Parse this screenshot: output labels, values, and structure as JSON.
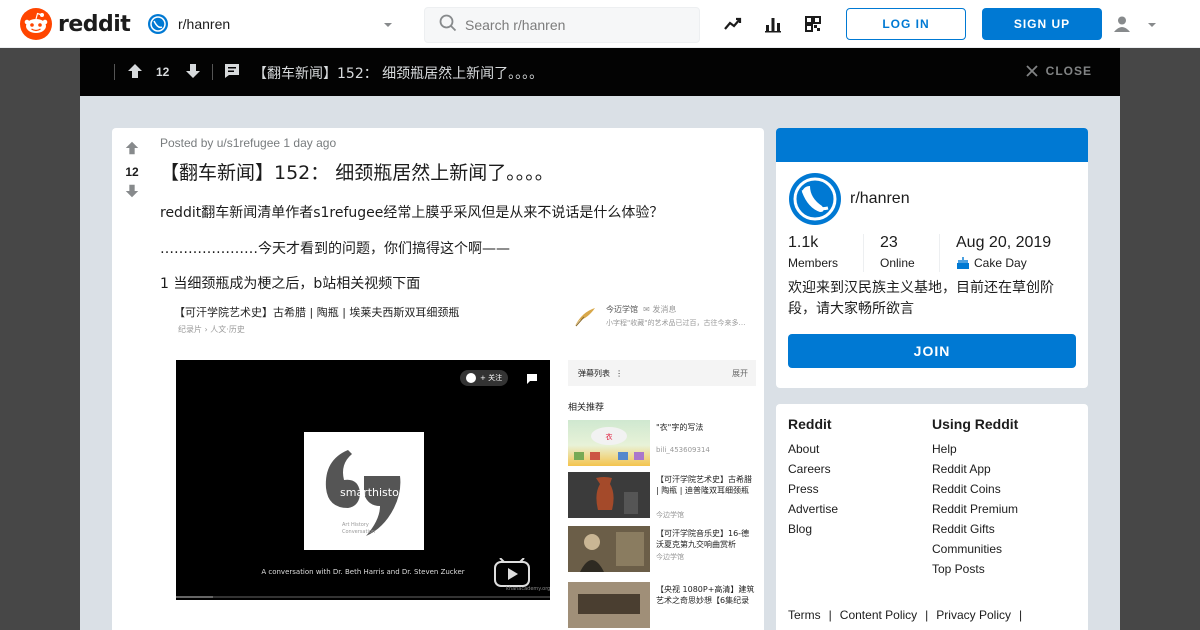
{
  "header": {
    "logo_text": "reddit",
    "community": "r/hanren",
    "search_placeholder": "Search r/hanren",
    "login_label": "LOG IN",
    "signup_label": "SIGN UP"
  },
  "topbar": {
    "score": "12",
    "title": "【翻车新闻】152： 细颈瓶居然上新闻了。。。。",
    "close_label": "CLOSE"
  },
  "post": {
    "score": "12",
    "meta": "Posted by u/s1refugee 1 day ago",
    "title": "【翻车新闻】152： 细颈瓶居然上新闻了。。。。",
    "paragraphs": [
      "reddit翻车新闻清单作者s1refugee经常上膜乎采风但是从来不说话是什么体验？",
      "…………………今天才看到的问题，你们搞得这个啊——",
      "1 当细颈瓶成为梗之后，b站相关视频下面"
    ]
  },
  "embed": {
    "video_title": "【可汗学院艺术史】古希腊 | 陶瓶 | 埃莱夫西斯双耳细颈瓶",
    "video_sub": "纪录片 › 人文·历史",
    "uploader": "今迈学馆",
    "uploader_tag": "发消息",
    "uploader_desc": "小字程\"收藏\"的艺术品已过百，古往今来多…",
    "follow": "+ 关注",
    "player_caption": "A conversation with Dr. Beth Harris and Dr. Steven Zucker",
    "logo_text": "smarthistory",
    "logo_sub1": "Art History",
    "logo_sub2": "Conversation",
    "watermark": "khanacademy.org",
    "danmu_label": "弹幕列表",
    "danmu_toggle": "展开",
    "rec_label": "相关推荐",
    "recs": [
      {
        "title": "\"衣\"字的写法",
        "sub": "bili_453609314"
      },
      {
        "title": "【可汗学院艺术史】古希腊 | 陶瓶 | 迪普隆双耳细颈瓶",
        "sub": "今边学馆"
      },
      {
        "title": "【可汗学院音乐史】16-德沃夏克第九交响曲赏析",
        "sub": "今边学馆"
      },
      {
        "title": "【央视 1080P+高清】建筑艺术之奇思妙想【6集纪录",
        "sub": ""
      }
    ]
  },
  "about": {
    "name": "r/hanren",
    "members_value": "1.1k",
    "members_label": "Members",
    "online_value": "23",
    "online_label": "Online",
    "cake_value": "Aug 20, 2019",
    "cake_label": "Cake Day",
    "description": "欢迎来到汉民族主义基地，目前还在草创阶段，请大家畅所欲言",
    "join_label": "JOIN"
  },
  "footer": {
    "col1_title": "Reddit",
    "col1": [
      "About",
      "Careers",
      "Press",
      "Advertise",
      "Blog"
    ],
    "col2_title": "Using Reddit",
    "col2": [
      "Help",
      "Reddit App",
      "Reddit Coins",
      "Reddit Premium",
      "Reddit Gifts",
      "Communities",
      "Top Posts"
    ],
    "links": [
      "Terms",
      "Content Policy",
      "Privacy Policy"
    ]
  },
  "colors": {
    "brand": "#ff4500",
    "accent": "#0079d3"
  }
}
